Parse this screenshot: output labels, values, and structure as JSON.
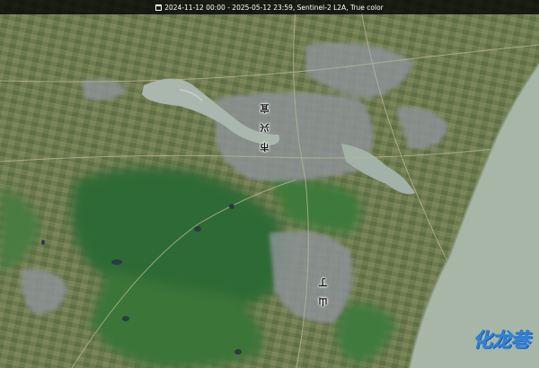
{
  "header": {
    "icon": "calendar-icon",
    "text": "2024-11-12 00:00 - 2025-05-12 23:59, Sentinel-2 L2A, True color"
  },
  "labels": {
    "city_a": "市 兴 宜",
    "town_a": "山 丁"
  },
  "logo": {
    "text": "化龙巷"
  },
  "colors": {
    "farmland": "#6c7a50",
    "forest": "#2f6a35",
    "urban": "#8e9599",
    "water": "#8fa399",
    "lake": "#a8b6ad"
  }
}
